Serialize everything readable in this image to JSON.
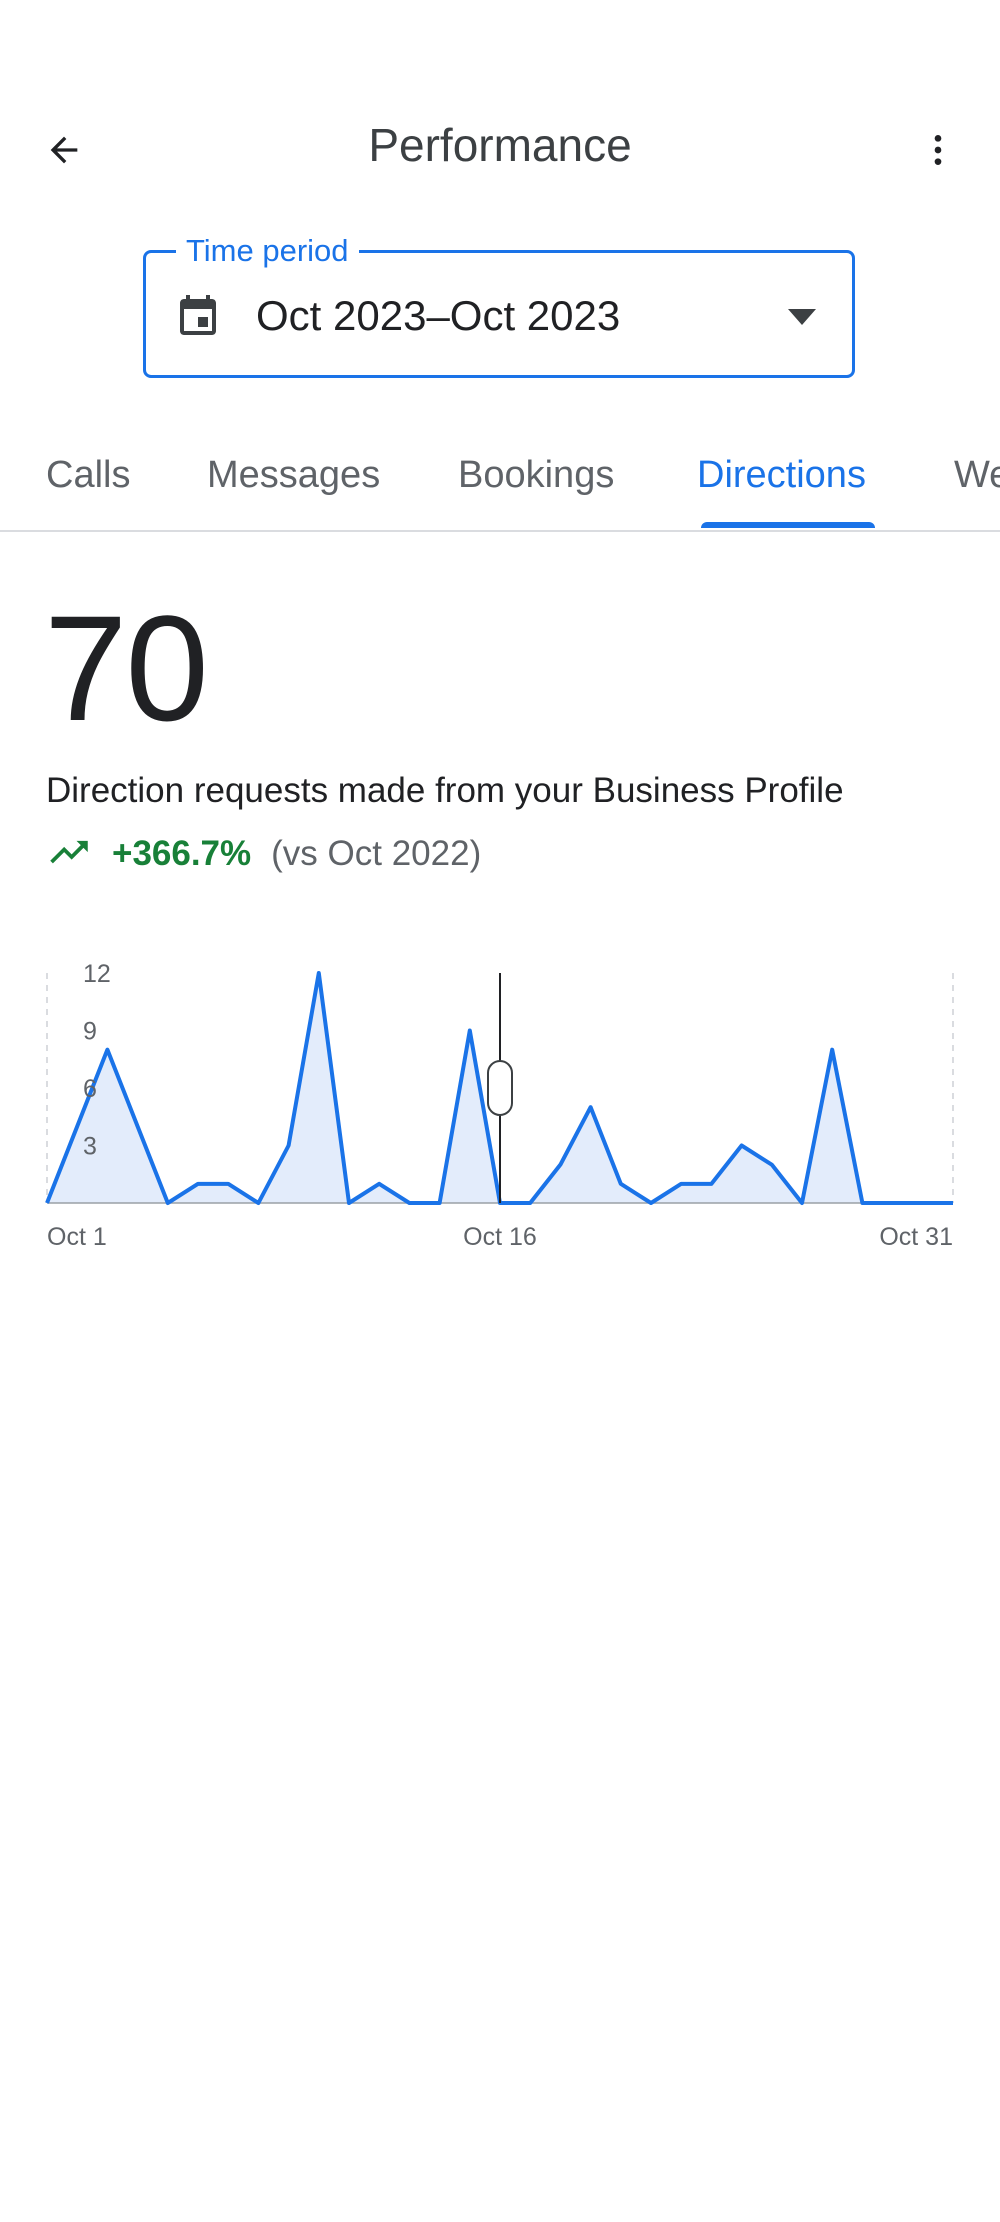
{
  "header": {
    "title": "Performance",
    "back_icon": "arrow-left-icon",
    "more_icon": "more-vert-icon"
  },
  "time_period": {
    "label": "Time period",
    "value": "Oct 2023–Oct 2023",
    "icon": "calendar-icon",
    "dropdown_icon": "dropdown-arrow-icon"
  },
  "tabs": [
    {
      "label": "Calls"
    },
    {
      "label": "Messages"
    },
    {
      "label": "Bookings"
    },
    {
      "label": "Directions",
      "active": true
    },
    {
      "label": "We"
    }
  ],
  "metric": {
    "value": "70",
    "description": "Direction requests made from your Business Profile",
    "change": "+366.7%",
    "comparison": "(vs Oct 2022)",
    "trend_icon": "trending-up-icon"
  },
  "colors": {
    "accent": "#1a73e8",
    "positive": "#188038",
    "text_secondary": "#5f6368"
  },
  "chart_data": {
    "type": "area",
    "x": [
      "Oct 1",
      "Oct 2",
      "Oct 3",
      "Oct 4",
      "Oct 5",
      "Oct 6",
      "Oct 7",
      "Oct 8",
      "Oct 9",
      "Oct 10",
      "Oct 11",
      "Oct 12",
      "Oct 13",
      "Oct 14",
      "Oct 15",
      "Oct 16",
      "Oct 17",
      "Oct 18",
      "Oct 19",
      "Oct 20",
      "Oct 21",
      "Oct 22",
      "Oct 23",
      "Oct 24",
      "Oct 25",
      "Oct 26",
      "Oct 27",
      "Oct 28",
      "Oct 29",
      "Oct 30",
      "Oct 31"
    ],
    "series": [
      {
        "values": [
          0,
          4,
          8,
          4,
          0,
          1,
          1,
          0,
          3,
          12,
          0,
          1,
          0,
          0,
          9,
          0,
          0,
          2,
          5,
          1,
          0,
          1,
          1,
          3,
          2,
          0,
          8,
          0,
          0,
          0,
          0
        ]
      }
    ],
    "y_ticks": [
      "3",
      "6",
      "9",
      "12"
    ],
    "x_tick_labels": [
      "Oct 1",
      "Oct 16",
      "Oct 31"
    ],
    "ylim": [
      0,
      12
    ],
    "grid": false,
    "selected_index": 15
  }
}
